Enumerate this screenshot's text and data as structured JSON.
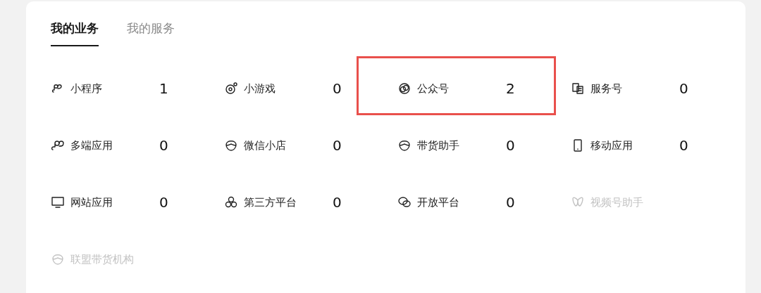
{
  "tabs": [
    {
      "label": "我的业务",
      "selected": true
    },
    {
      "label": "我的服务",
      "selected": false
    }
  ],
  "services": [
    {
      "label": "小程序",
      "count": "1",
      "highlighted": false,
      "disabled": false
    },
    {
      "label": "小游戏",
      "count": "0",
      "highlighted": false,
      "disabled": false
    },
    {
      "label": "公众号",
      "count": "2",
      "highlighted": true,
      "disabled": false
    },
    {
      "label": "服务号",
      "count": "0",
      "highlighted": false,
      "disabled": false
    },
    {
      "label": "多端应用",
      "count": "0",
      "highlighted": false,
      "disabled": false
    },
    {
      "label": "微信小店",
      "count": "0",
      "highlighted": false,
      "disabled": false
    },
    {
      "label": "带货助手",
      "count": "0",
      "highlighted": false,
      "disabled": false
    },
    {
      "label": "移动应用",
      "count": "0",
      "highlighted": false,
      "disabled": false
    },
    {
      "label": "网站应用",
      "count": "0",
      "highlighted": false,
      "disabled": false
    },
    {
      "label": "第三方平台",
      "count": "0",
      "highlighted": false,
      "disabled": false
    },
    {
      "label": "开放平台",
      "count": "0",
      "highlighted": false,
      "disabled": false
    },
    {
      "label": "视频号助手",
      "highlighted": false,
      "disabled": true
    },
    {
      "label": "联盟带货机构",
      "highlighted": false,
      "disabled": true
    }
  ]
}
